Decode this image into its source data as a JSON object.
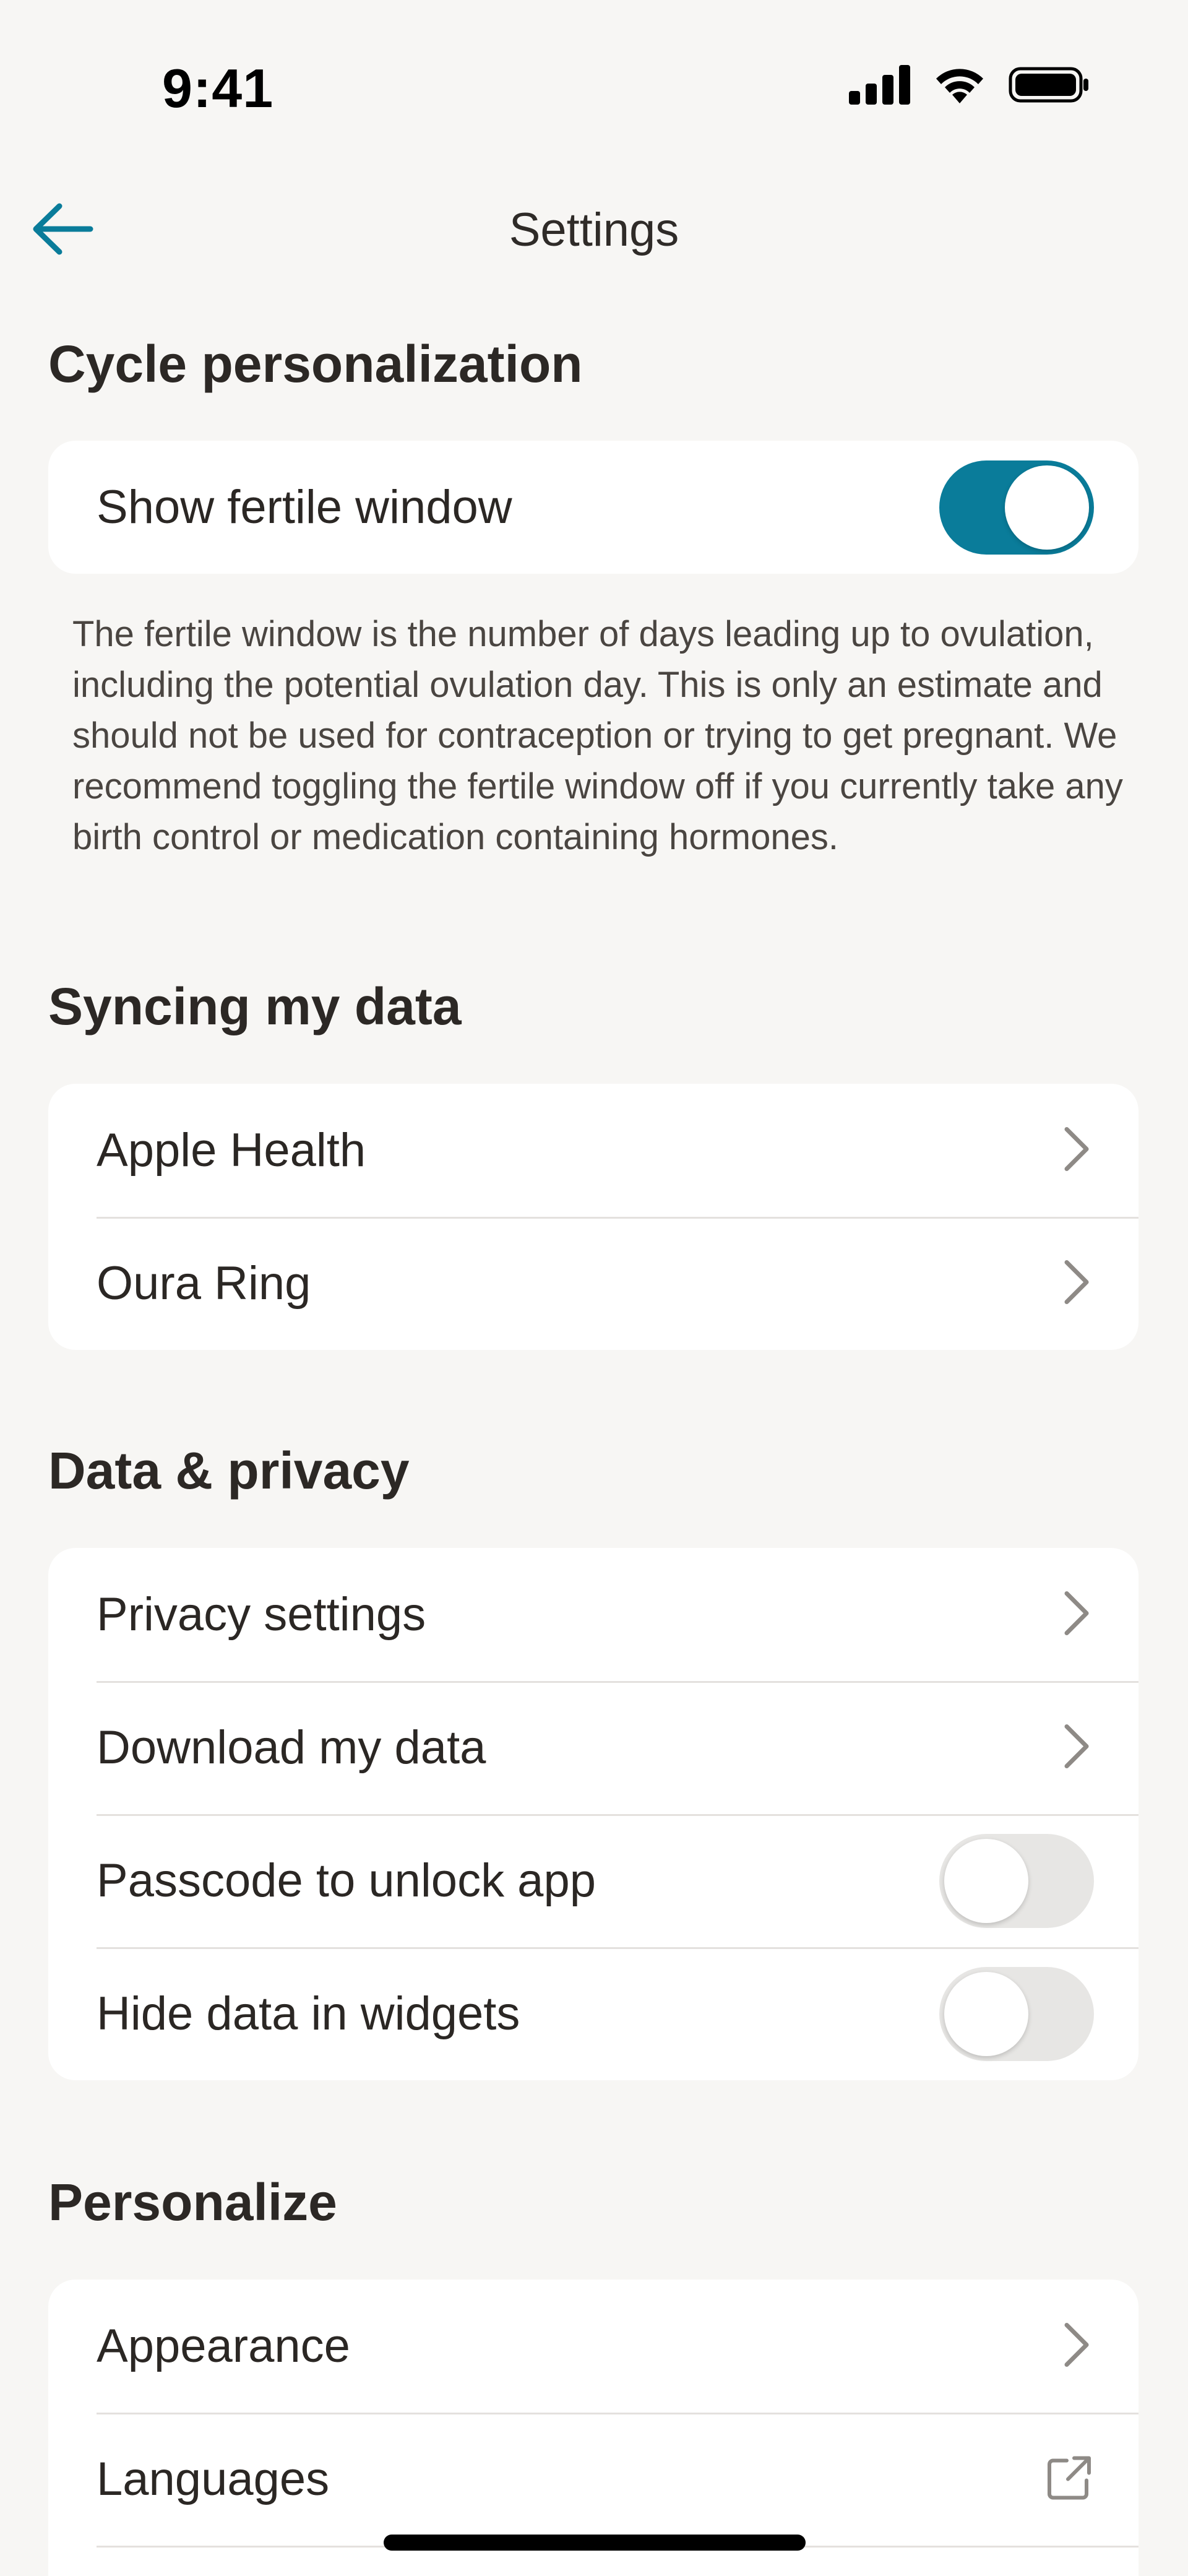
{
  "status_bar": {
    "time": "9:41",
    "icons": [
      "cellular-signal-icon",
      "wifi-icon",
      "battery-icon"
    ]
  },
  "header": {
    "title": "Settings",
    "back_icon": "arrow-left-icon"
  },
  "colors": {
    "accent": "#0a7c9a",
    "background": "#f7f6f4",
    "card": "#ffffff",
    "toggle_off": "#e7e6e4",
    "chevron": "#8e8a86"
  },
  "cycle": {
    "title": "Cycle personalization",
    "show_fertile_window": {
      "label": "Show fertile window",
      "toggle": "on"
    },
    "note": "The fertile window is the number of days leading up to ovulation, including the potential ovulation day. This is only an estimate and should not be used for contraception or trying to get pregnant. We recommend toggling the fertile window off if you currently take any birth control or medication containing hormones."
  },
  "syncing": {
    "title": "Syncing my data",
    "items": [
      {
        "label": "Apple Health",
        "icon": "chevron-right-icon"
      },
      {
        "label": "Oura Ring",
        "icon": "chevron-right-icon"
      }
    ]
  },
  "privacy": {
    "title": "Data & privacy",
    "items": [
      {
        "label": "Privacy settings",
        "icon": "chevron-right-icon"
      },
      {
        "label": "Download my data",
        "icon": "chevron-right-icon"
      },
      {
        "label": "Passcode to unlock app",
        "toggle": "off"
      },
      {
        "label": "Hide data in widgets",
        "toggle": "off"
      }
    ]
  },
  "personalize": {
    "title": "Personalize",
    "items": [
      {
        "label": "Appearance",
        "icon": "chevron-right-icon"
      },
      {
        "label": "Languages",
        "icon": "external-link-icon"
      }
    ]
  }
}
